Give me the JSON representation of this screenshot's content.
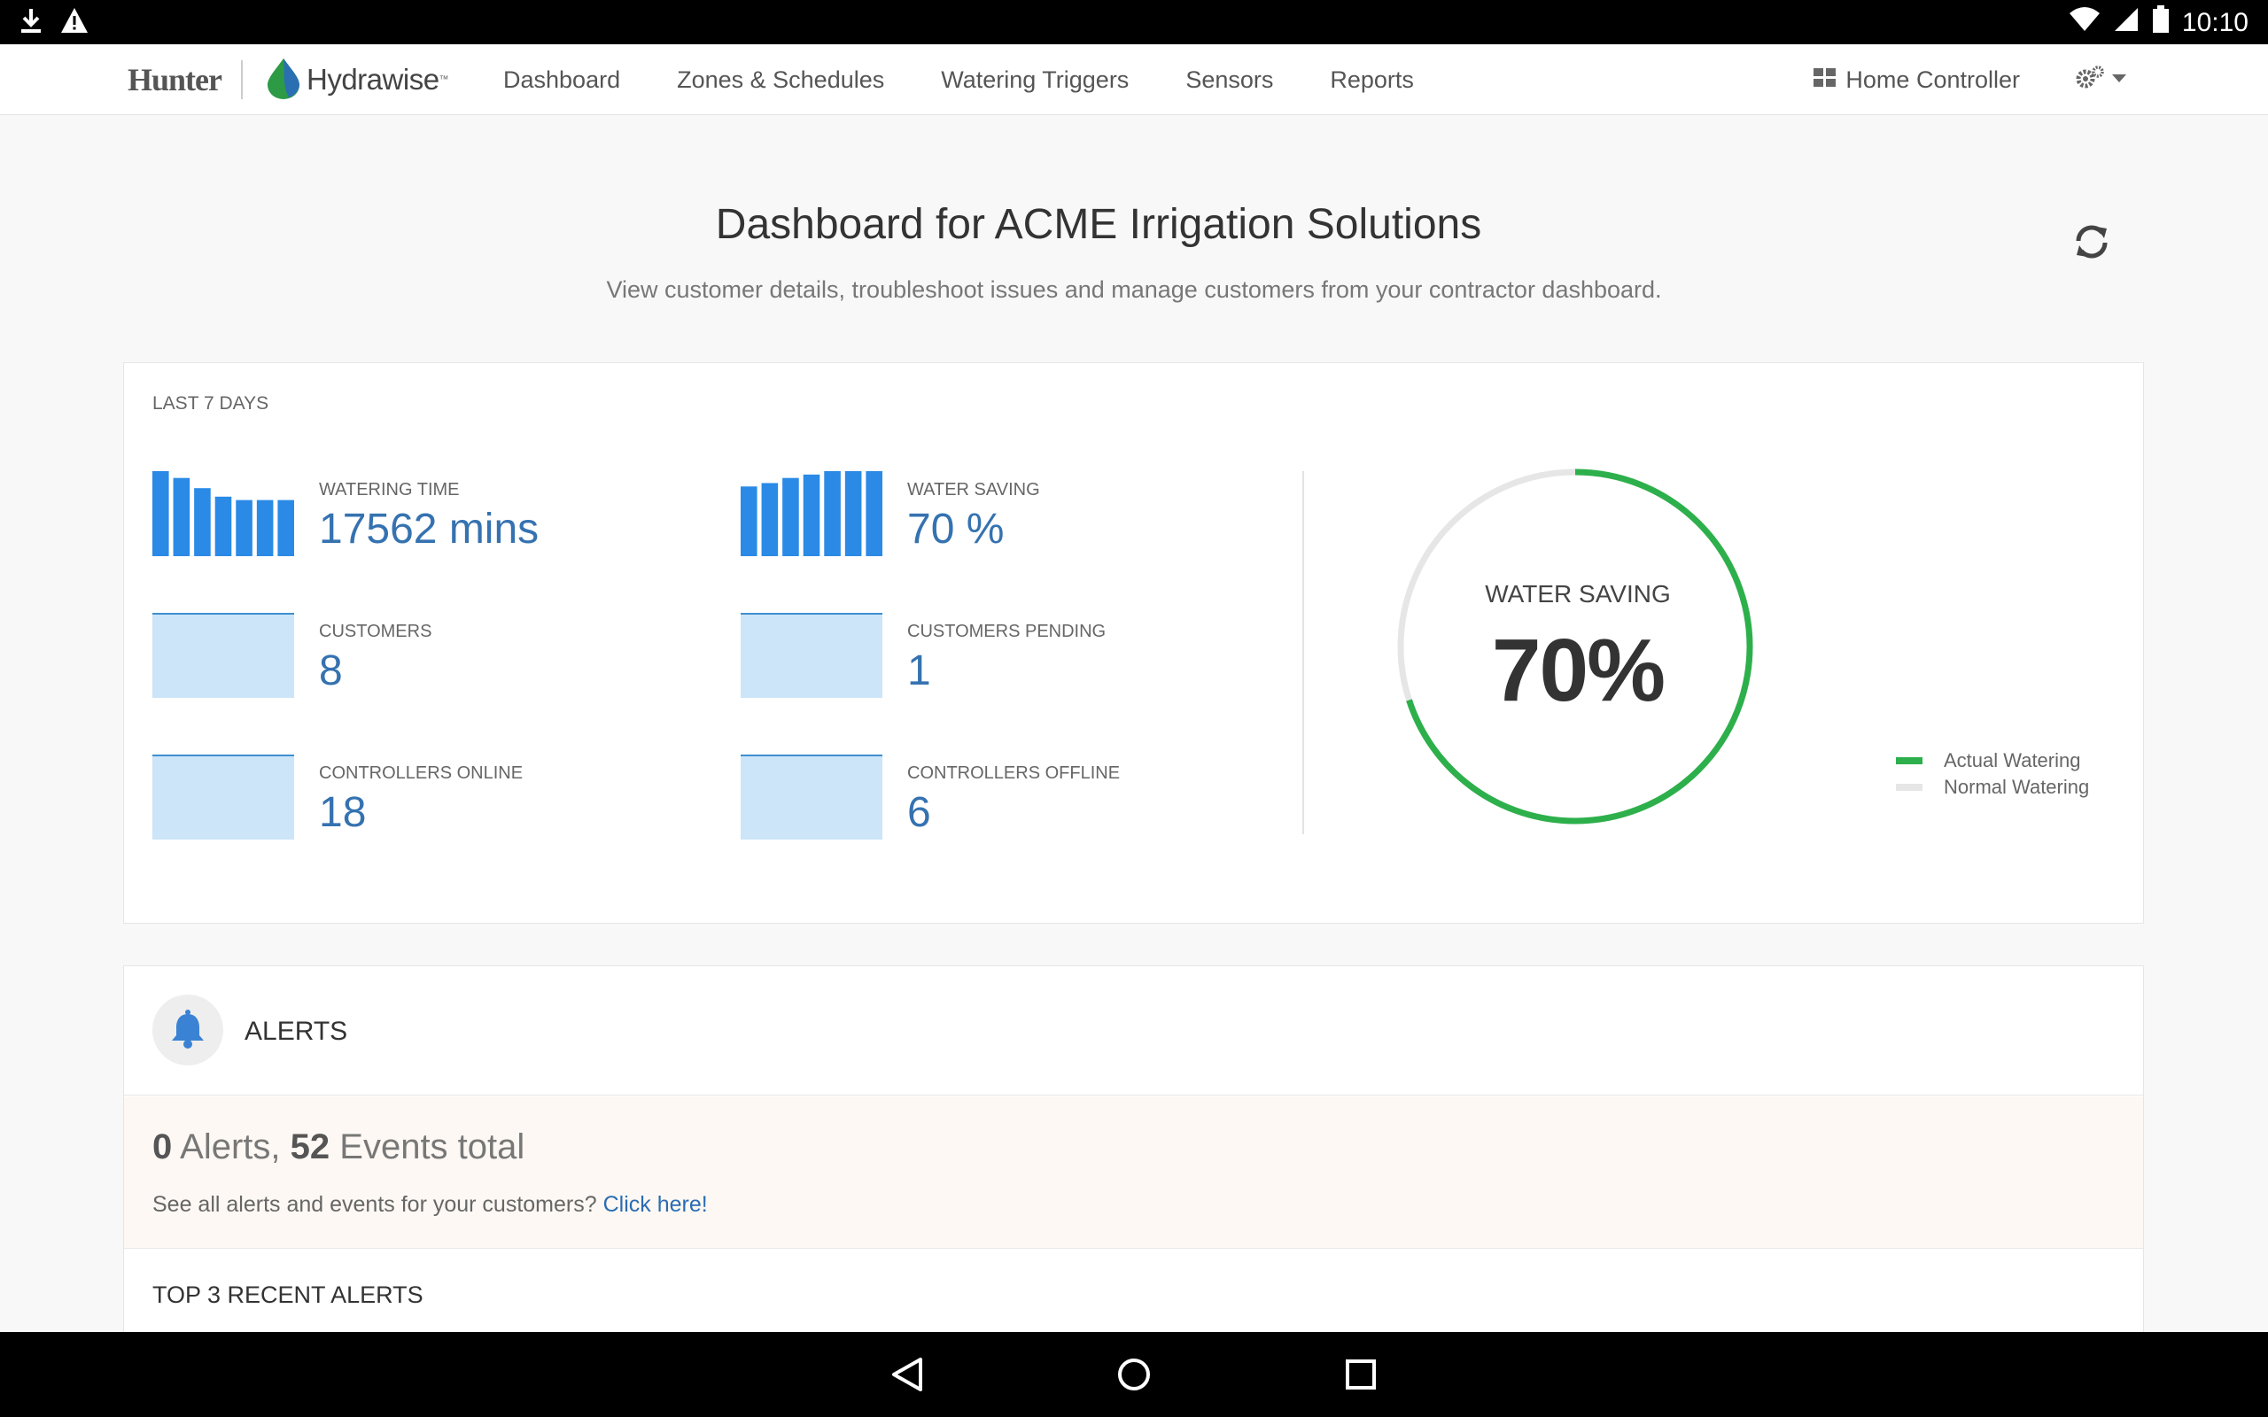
{
  "status_bar": {
    "time": "10:10"
  },
  "brand": {
    "hunter": "Hunter",
    "hydrawise": "Hydrawise",
    "tm": "™"
  },
  "nav": {
    "links": [
      "Dashboard",
      "Zones & Schedules",
      "Watering Triggers",
      "Sensors",
      "Reports"
    ],
    "controller": "Home Controller"
  },
  "header": {
    "title": "Dashboard for ACME Irrigation Solutions",
    "subtitle": "View customer details, troubleshoot issues and manage customers from your contractor dashboard."
  },
  "stats": {
    "period": "LAST 7 DAYS",
    "watering_time": {
      "label": "WATERING TIME",
      "value": "17562 mins",
      "bars": [
        100,
        92,
        80,
        70,
        66,
        66,
        66
      ]
    },
    "water_saving": {
      "label": "WATER SAVING",
      "value": "70 %",
      "bars": [
        82,
        86,
        92,
        96,
        100,
        100,
        100
      ]
    },
    "customers": {
      "label": "CUSTOMERS",
      "value": "8"
    },
    "customers_pending": {
      "label": "CUSTOMERS PENDING",
      "value": "1"
    },
    "controllers_online": {
      "label": "CONTROLLERS ONLINE",
      "value": "18"
    },
    "controllers_offline": {
      "label": "CONTROLLERS OFFLINE",
      "value": "6"
    }
  },
  "gauge": {
    "label": "WATER SAVING",
    "value": "70%",
    "fraction": 0.7,
    "actual_color": "#2db04b",
    "normal_color": "#e6e6e6"
  },
  "legend": {
    "actual": "Actual Watering",
    "normal": "Normal Watering"
  },
  "alerts": {
    "title": "ALERTS",
    "alert_count": "0",
    "alerts_word": "Alerts,",
    "event_count": "52",
    "events_word": "Events total",
    "prompt": "See all alerts and events for your customers?",
    "link": "Click here!",
    "recent_title": "TOP 3 RECENT ALERTS"
  },
  "colors": {
    "accent": "#3572b0",
    "bar_blue": "#2a8ae6",
    "box_blue": "#cce5f8"
  }
}
